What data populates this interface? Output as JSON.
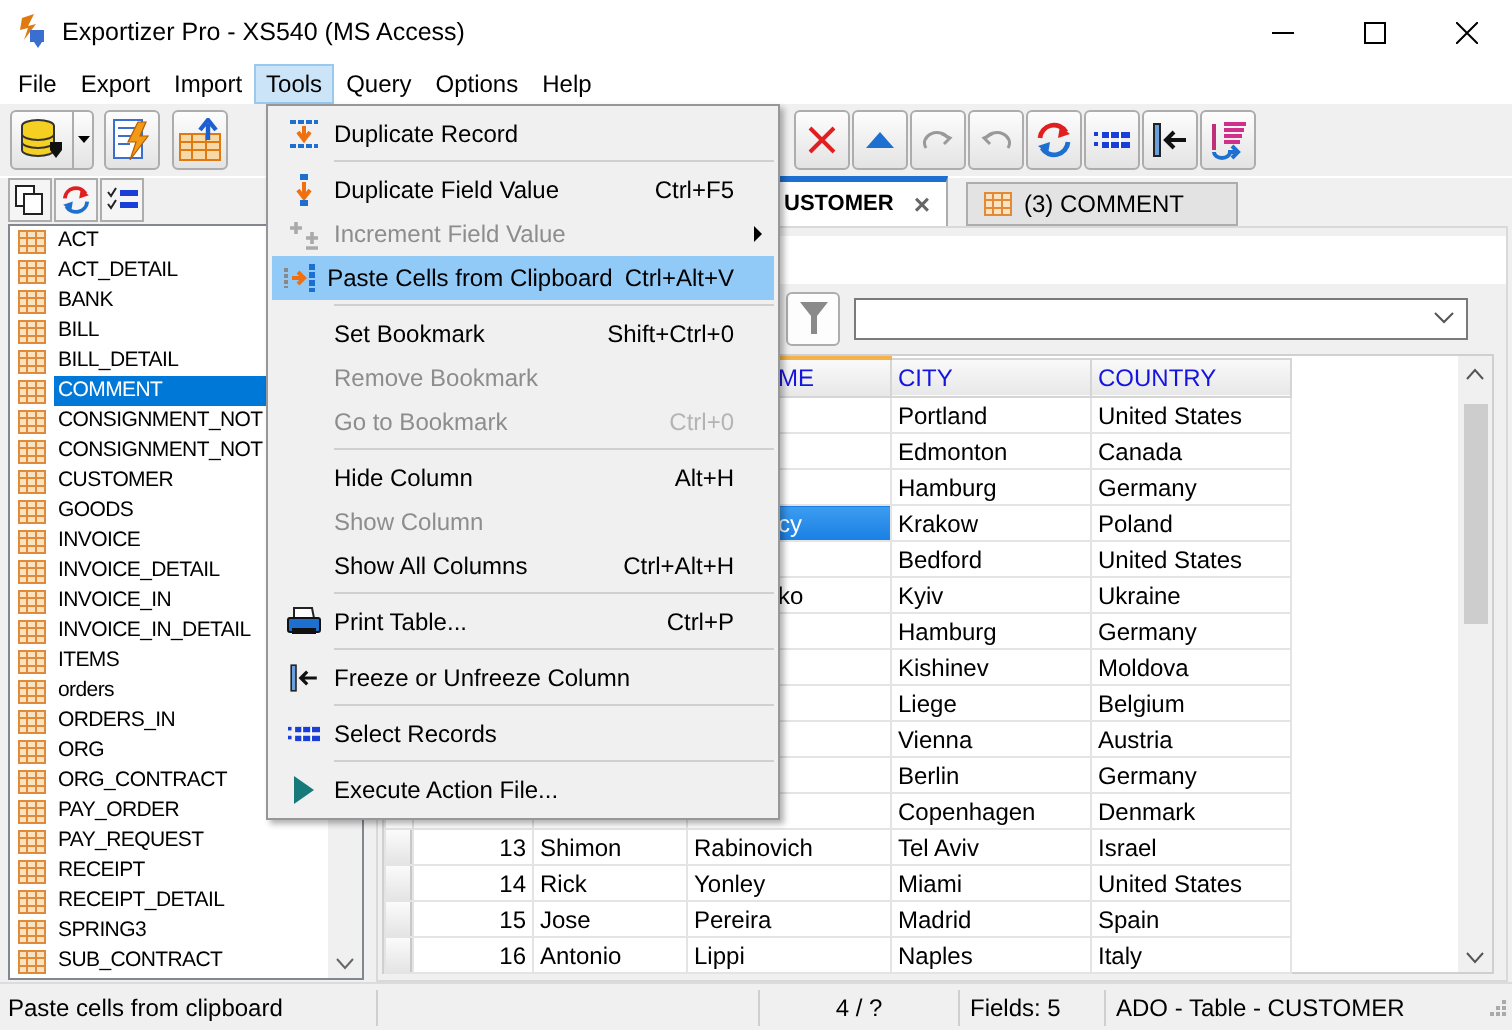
{
  "window": {
    "title": "Exportizer Pro - XS540 (MS Access)"
  },
  "menubar": [
    {
      "label": "File",
      "selected": false
    },
    {
      "label": "Export",
      "selected": false
    },
    {
      "label": "Import",
      "selected": false
    },
    {
      "label": "Tools",
      "selected": true
    },
    {
      "label": "Query",
      "selected": false
    },
    {
      "label": "Options",
      "selected": false
    },
    {
      "label": "Help",
      "selected": false
    }
  ],
  "sidebar": {
    "items": [
      {
        "label": "ACT",
        "selected": false
      },
      {
        "label": "ACT_DETAIL",
        "selected": false
      },
      {
        "label": "BANK",
        "selected": false
      },
      {
        "label": "BILL",
        "selected": false
      },
      {
        "label": "BILL_DETAIL",
        "selected": false
      },
      {
        "label": "COMMENT",
        "selected": true
      },
      {
        "label": "CONSIGNMENT_NOT",
        "selected": false
      },
      {
        "label": "CONSIGNMENT_NOT",
        "selected": false
      },
      {
        "label": "CUSTOMER",
        "selected": false
      },
      {
        "label": "GOODS",
        "selected": false
      },
      {
        "label": "INVOICE",
        "selected": false
      },
      {
        "label": "INVOICE_DETAIL",
        "selected": false
      },
      {
        "label": "INVOICE_IN",
        "selected": false
      },
      {
        "label": "INVOICE_IN_DETAIL",
        "selected": false
      },
      {
        "label": "ITEMS",
        "selected": false
      },
      {
        "label": "orders",
        "selected": false
      },
      {
        "label": "ORDERS_IN",
        "selected": false
      },
      {
        "label": "ORG",
        "selected": false
      },
      {
        "label": "ORG_CONTRACT",
        "selected": false
      },
      {
        "label": "PAY_ORDER",
        "selected": false
      },
      {
        "label": "PAY_REQUEST",
        "selected": false
      },
      {
        "label": "RECEIPT",
        "selected": false
      },
      {
        "label": "RECEIPT_DETAIL",
        "selected": false
      },
      {
        "label": "SPRING3",
        "selected": false
      },
      {
        "label": "SUB_CONTRACT",
        "selected": false
      }
    ]
  },
  "tabs": [
    {
      "label": "USTOMER",
      "selected": true,
      "close": "×"
    },
    {
      "label": "(3) COMMENT",
      "selected": false
    }
  ],
  "table": {
    "header": {
      "column_3": "ME",
      "city": "CITY",
      "country": "COUNTRY"
    },
    "rows": [
      {
        "city": "Portland",
        "country": "United States",
        "selected": false
      },
      {
        "city": "Edmonton",
        "country": "Canada",
        "selected": false
      },
      {
        "city": "Hamburg",
        "country": "Germany",
        "selected": false
      },
      {
        "column_3": "cy",
        "city": "Krakow",
        "country": "Poland",
        "selected": true
      },
      {
        "city": "Bedford",
        "country": "United States",
        "selected": false
      },
      {
        "column_3": "ko",
        "city": "Kyiv",
        "country": "Ukraine",
        "selected": false
      },
      {
        "city": "Hamburg",
        "country": "Germany",
        "selected": false
      },
      {
        "city": "Kishinev",
        "country": "Moldova",
        "selected": false
      },
      {
        "city": "Liege",
        "country": "Belgium",
        "selected": false
      },
      {
        "city": "Vienna",
        "country": "Austria",
        "selected": false
      },
      {
        "city": "Berlin",
        "country": "Germany",
        "selected": false
      },
      {
        "city": "Copenhagen",
        "country": "Denmark",
        "selected": false
      },
      {
        "column_1": "13",
        "column_2": "Shimon",
        "column_3": "Rabinovich",
        "city": "Tel Aviv",
        "country": "Israel",
        "selected": false
      },
      {
        "column_1": "14",
        "column_2": "Rick",
        "column_3": "Yonley",
        "city": "Miami",
        "country": "United States",
        "selected": false
      },
      {
        "column_1": "15",
        "column_2": "Jose",
        "column_3": "Pereira",
        "city": "Madrid",
        "country": "Spain",
        "selected": false
      },
      {
        "column_1": "16",
        "column_2": "Antonio",
        "column_3": "Lippi",
        "city": "Naples",
        "country": "Italy",
        "selected": false
      }
    ]
  },
  "tools_menu": [
    {
      "kind": "item",
      "label": "Duplicate Record",
      "disabled": false,
      "selected": false,
      "submenu": false
    },
    {
      "kind": "separator"
    },
    {
      "kind": "item",
      "label": "Duplicate Field Value",
      "shortcut": "Ctrl+F5",
      "disabled": false,
      "selected": false,
      "submenu": false
    },
    {
      "kind": "item",
      "label": "Increment Field Value",
      "disabled": true,
      "selected": false,
      "submenu": true
    },
    {
      "kind": "item",
      "label": "Paste Cells from Clipboard",
      "shortcut": "Ctrl+Alt+V",
      "disabled": false,
      "selected": true,
      "submenu": false
    },
    {
      "kind": "separator"
    },
    {
      "kind": "item",
      "label": "Set Bookmark",
      "shortcut": "Shift+Ctrl+0",
      "disabled": false,
      "selected": false,
      "submenu": false
    },
    {
      "kind": "item",
      "label": "Remove Bookmark",
      "disabled": true,
      "selected": false,
      "submenu": false
    },
    {
      "kind": "item",
      "label": "Go to Bookmark",
      "shortcut": "Ctrl+0",
      "disabled": true,
      "selected": false,
      "submenu": false
    },
    {
      "kind": "separator"
    },
    {
      "kind": "item",
      "label": "Hide Column",
      "shortcut": "Alt+H",
      "disabled": false,
      "selected": false,
      "submenu": false
    },
    {
      "kind": "item",
      "label": "Show Column",
      "disabled": true,
      "selected": false,
      "submenu": false
    },
    {
      "kind": "item",
      "label": "Show All Columns",
      "shortcut": "Ctrl+Alt+H",
      "disabled": false,
      "selected": false,
      "submenu": false
    },
    {
      "kind": "separator"
    },
    {
      "kind": "item",
      "label": "Print Table...",
      "shortcut": "Ctrl+P",
      "disabled": false,
      "selected": false,
      "submenu": false
    },
    {
      "kind": "separator"
    },
    {
      "kind": "item",
      "label": "Freeze or Unfreeze Column",
      "disabled": false,
      "selected": false,
      "submenu": false
    },
    {
      "kind": "separator"
    },
    {
      "kind": "item",
      "label": "Select Records",
      "disabled": false,
      "selected": false,
      "submenu": false
    },
    {
      "kind": "separator"
    },
    {
      "kind": "item",
      "label": "Execute Action File...",
      "disabled": false,
      "selected": false,
      "submenu": false
    }
  ],
  "status_bar": {
    "hint": "Paste cells from clipboard",
    "position": "4 / ?",
    "fields": "Fields: 5",
    "source": "ADO - Table - CUSTOMER"
  }
}
